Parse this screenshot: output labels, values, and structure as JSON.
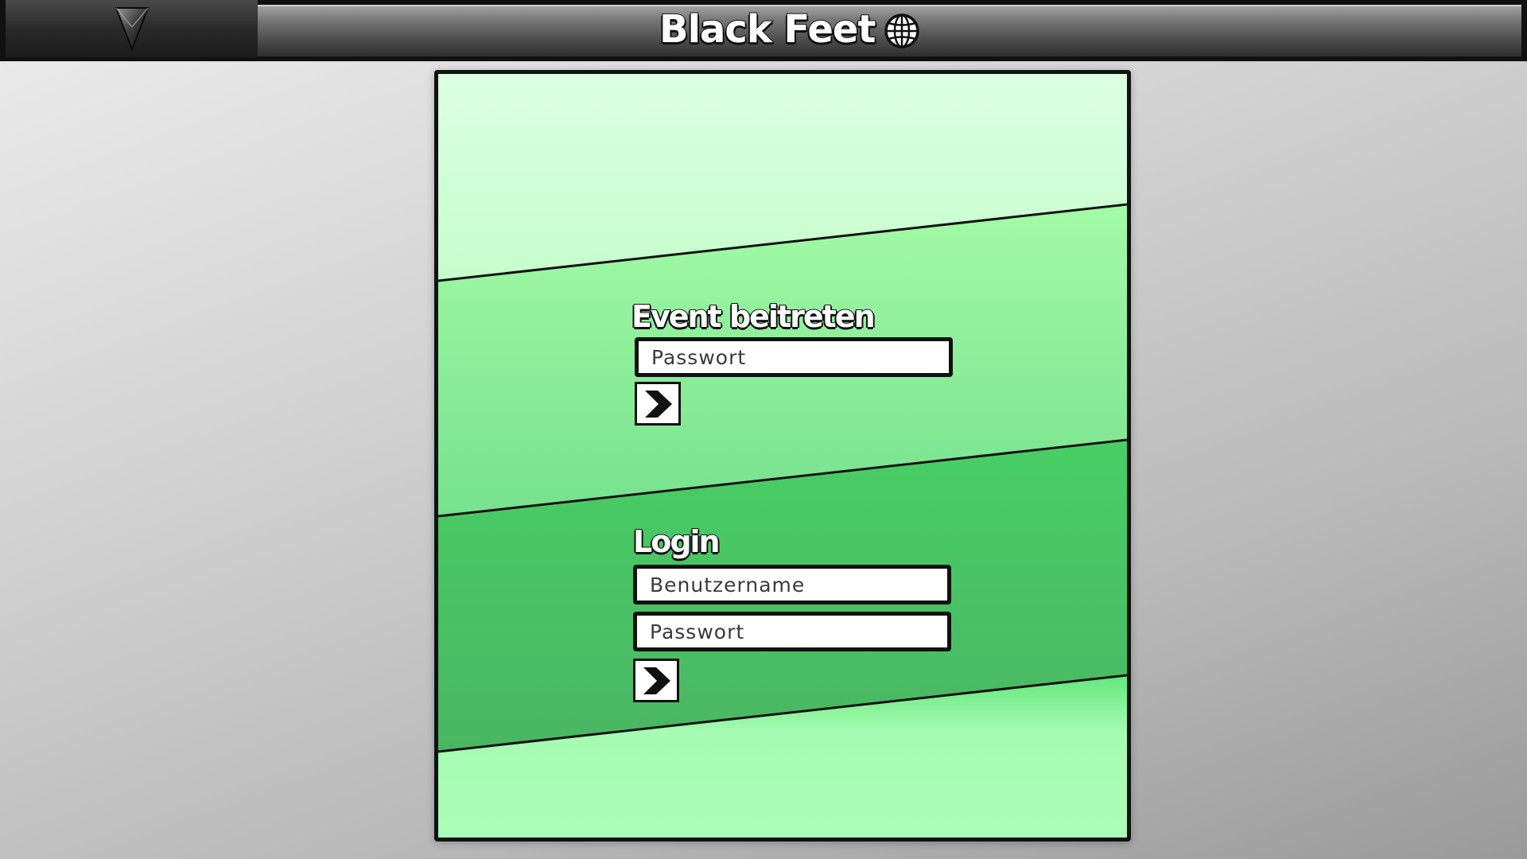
{
  "app": {
    "title": "Black Feet",
    "menu_icon": "triangle-down-logo-icon",
    "language_icon": "globe-icon"
  },
  "event_section": {
    "title": "Event beitreten",
    "password_placeholder": "Passwort",
    "submit_icon": "arrow-right-icon"
  },
  "login_section": {
    "title": "Login",
    "username_placeholder": "Benutzername",
    "password_placeholder": "Passwort",
    "submit_icon": "arrow-right-icon"
  },
  "colors": {
    "band_top": "#dbffe1",
    "band_upper": "#9df9a1",
    "band_lower": "#46c863",
    "band_bottom": "#a8fbb4",
    "outline": "#111111",
    "header_dark": "#2a2a2a"
  }
}
